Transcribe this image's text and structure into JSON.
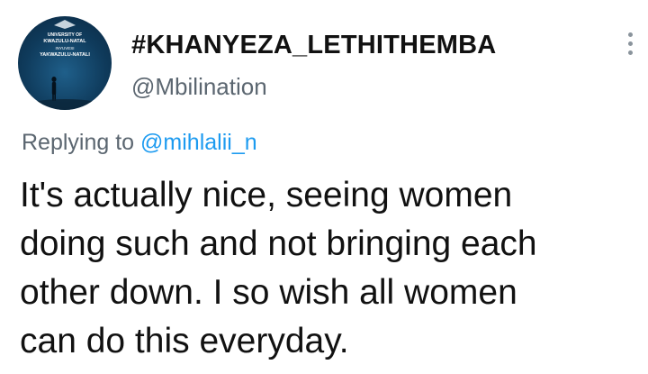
{
  "tweet": {
    "avatar": {
      "icon": "university-logo-avatar",
      "text_line_1": "UNIVERSITY OF",
      "text_line_2": "KWAZULU-NATAL",
      "text_line_3": "INYUVESI",
      "text_line_4": "YAKWAZULU-NATALI"
    },
    "display_name": "#KHANYEZA_LETHITHEMBA",
    "handle": "@Mbilination",
    "more_icon": "more-vertical-icon",
    "reply_prefix": "Replying to",
    "reply_to": "@mihlalii_n",
    "text": "It's actually nice, seeing women\ndoing such and not bringing each\nother down. I so wish all women\ncan do this everyday.",
    "colors": {
      "link": "#1d9bf0",
      "secondary_text": "#5b6670",
      "primary_text": "#111111"
    }
  }
}
